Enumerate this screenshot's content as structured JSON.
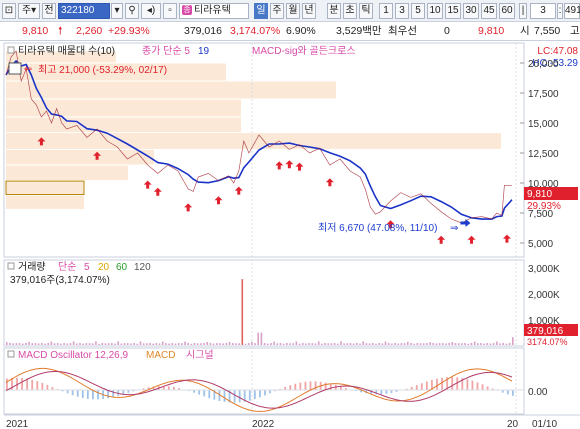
{
  "toolbar": {
    "mode_main": "주",
    "mode_jeon": "전",
    "code": "322180",
    "stock_badge": "종",
    "stock_name": "티라유텍",
    "periods": [
      "일",
      "주",
      "월",
      "년",
      "분",
      "초",
      "틱"
    ],
    "active_period": "일",
    "minutes": [
      "1",
      "3",
      "5",
      "10",
      "15",
      "30",
      "45",
      "60"
    ],
    "count_value": "3",
    "right_value": "491"
  },
  "price_row": {
    "price": "9,810",
    "change": "2,260",
    "change_pct": "+29.93%",
    "volume": "379,016",
    "volume_pct": "3,174.07%",
    "turnover": "6.90%",
    "amount": "3,529백만",
    "min_label": "최우선",
    "min_value": "0",
    "last_price": "9,810",
    "open_label": "시",
    "open_value": "7,550",
    "high_label": "고"
  },
  "legend": {
    "main": "티라유텍 매물대 수(10)",
    "ma": "종가 단순 5",
    "ma2": "19",
    "macd": "MACD-sig와 골든크로스",
    "lc": "LC:47.08",
    "hc": "HC:-53.29"
  },
  "annotations": {
    "high": "최고 21,000 (-53.29%, 02/17)",
    "low": "최저 6,670 (47.08%, 11/10)",
    "price_tag": "9,810",
    "price_tag_pct": "29.93%",
    "vol_tag": "379,016",
    "vol_tag_pct": "3174.07%"
  },
  "price_axis": [
    "20,000",
    "17,500",
    "15,000",
    "12,500",
    "10,000",
    "7,500",
    "5,000"
  ],
  "volume_panel": {
    "legend": "거래량",
    "ma_label": "단순",
    "mas": [
      "5",
      "20",
      "60",
      "120"
    ],
    "current": "379,016주(3,174.07%)",
    "axis": [
      "3,000K",
      "2,000K",
      "1,000K"
    ]
  },
  "macd_panel": {
    "legend": "MACD Oscillator 12,26,9",
    "macd": "MACD",
    "signal": "시그널",
    "axis": "0.00"
  },
  "x_axis": {
    "labels": [
      "2021",
      "2022",
      "20",
      "01/10"
    ]
  },
  "colors": {
    "price_line": "#1a33c8",
    "candle_up": "#e0212d",
    "candle_down": "#1e3ccf",
    "volume_bar": "#f2c9b0"
  },
  "chart_data": {
    "type": "line",
    "title": "티라유텍 매물대 수(10)",
    "price_series_approx": [
      {
        "x": "2021-01",
        "y": 19000
      },
      {
        "x": "2021-02",
        "y": 21000
      },
      {
        "x": "2021-03",
        "y": 15500
      },
      {
        "x": "2021-05",
        "y": 14500
      },
      {
        "x": "2021-07",
        "y": 12000
      },
      {
        "x": "2021-09",
        "y": 9500
      },
      {
        "x": "2021-11",
        "y": 10500
      },
      {
        "x": "2022-01",
        "y": 13000
      },
      {
        "x": "2022-03",
        "y": 12500
      },
      {
        "x": "2022-05",
        "y": 11000
      },
      {
        "x": "2022-07",
        "y": 7500
      },
      {
        "x": "2022-09",
        "y": 8500
      },
      {
        "x": "2022-11",
        "y": 6670
      },
      {
        "x": "2023-01",
        "y": 9810
      }
    ],
    "ylim": [
      4000,
      21500
    ]
  }
}
